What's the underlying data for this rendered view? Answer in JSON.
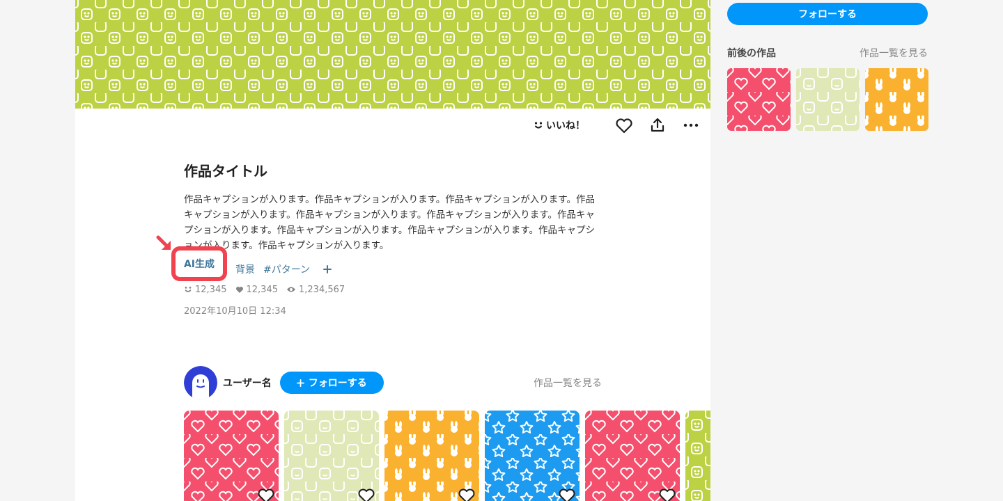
{
  "colors": {
    "accent": "#0096fa",
    "tag": "#3d7699",
    "highlight": "#f0434f",
    "pattern_green": "#bcd143",
    "pattern_red": "#f44f6d",
    "pattern_lightgreen": "#dfe8b6",
    "pattern_orange": "#f9b12f",
    "pattern_blue": "#1d9bf0"
  },
  "actions": {
    "like_text": "いいね！"
  },
  "work": {
    "title": "作品タイトル",
    "caption": "作品キャプションが入ります。作品キャプションが入ります。作品キャプションが入ります。作品キャプションが入ります。作品キャプションが入ります。作品キャプションが入ります。作品キャプションが入ります。作品キャプションが入ります。作品キャプションが入ります。作品キャプションが入ります。作品キャプションが入ります。",
    "tags": {
      "ai": "AI生成",
      "background": "背景",
      "pattern": "#パターン"
    },
    "stats": {
      "likes": "12,345",
      "bookmarks": "12,345",
      "views": "1,234,567"
    },
    "date": "2022年10月10日 12:34"
  },
  "user": {
    "name": "ユーザー名",
    "follow_label": "フォローする",
    "see_all": "作品一覧を見る"
  },
  "sidebar": {
    "follow_label": "フォローする",
    "title": "前後の作品",
    "see_all": "作品一覧を見る"
  }
}
